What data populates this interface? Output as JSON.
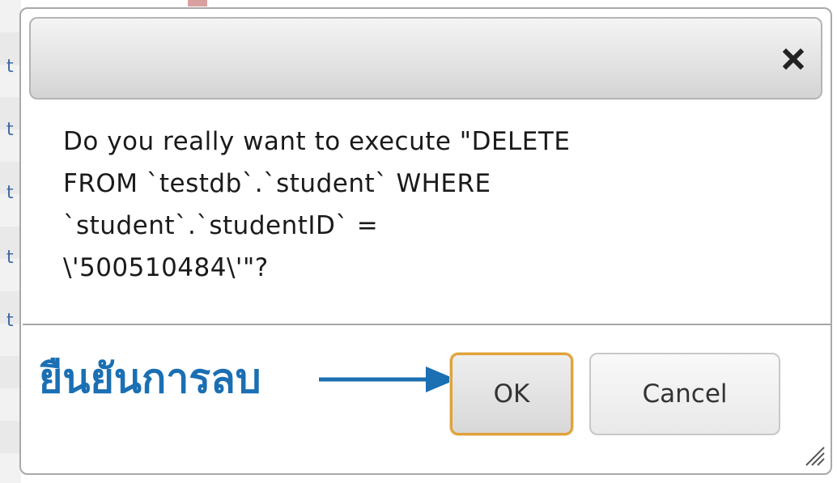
{
  "dialog": {
    "close_icon": "close-icon",
    "message": "Do you really want to execute \"DELETE\nFROM `testdb`.`student` WHERE\n`student`.`studentID` =\n\\'500510484\\'\"?",
    "ok_label": "OK",
    "cancel_label": "Cancel",
    "resize_icon": "resize-grip-icon"
  },
  "annotation": {
    "text": "ยืนยันการลบ",
    "color": "#1b6fb3",
    "arrow_icon": "arrow-right-icon"
  },
  "background": {
    "row_chars": [
      "t",
      "t",
      "t",
      "t",
      "t"
    ]
  },
  "colors": {
    "ok_border": "#e0a23a",
    "annotation": "#1b6fb3"
  }
}
